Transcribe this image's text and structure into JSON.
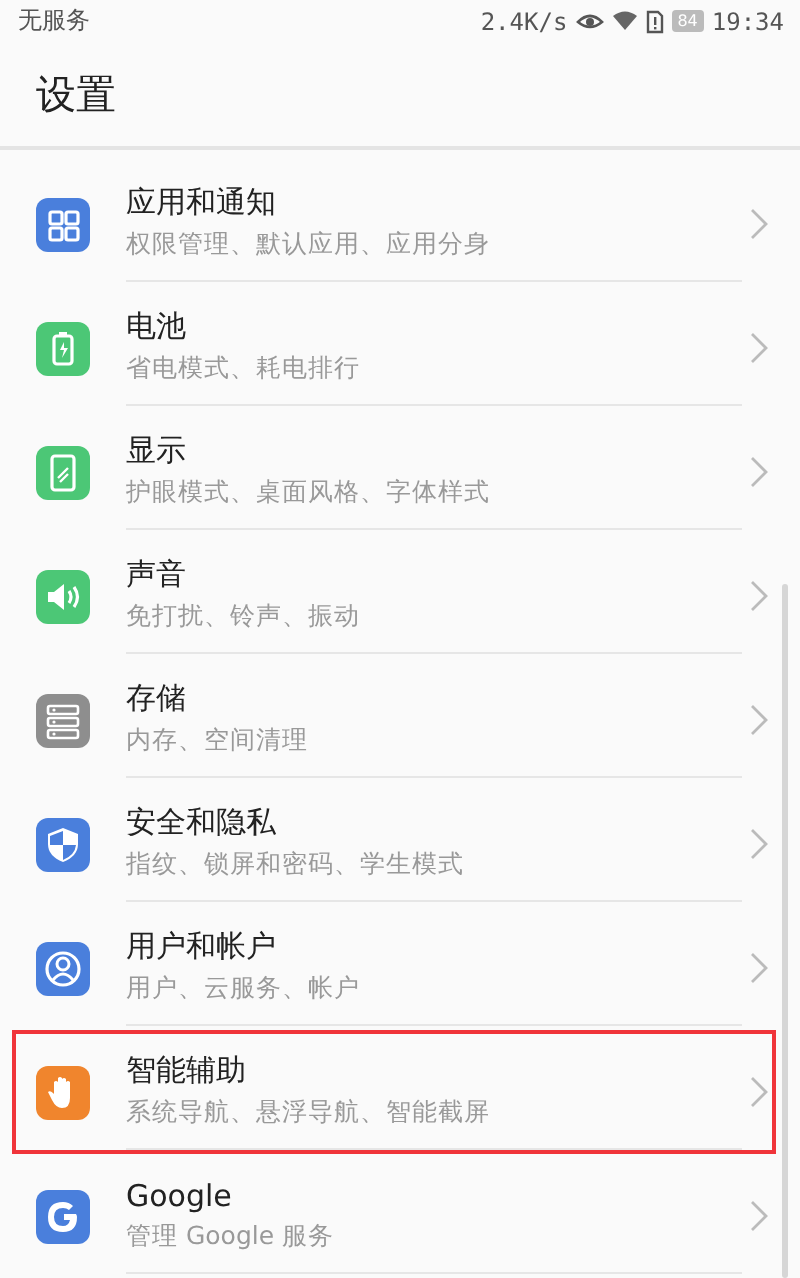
{
  "status_bar": {
    "carrier": "无服务",
    "speed": "2.4K/s",
    "battery": "84",
    "time": "19:34"
  },
  "title": "设置",
  "items": [
    {
      "kind": "apps",
      "color": "#4a7fdc",
      "title": "应用和通知",
      "subtitle": "权限管理、默认应用、应用分身",
      "highlighted": false
    },
    {
      "kind": "battery",
      "color": "#4cc776",
      "title": "电池",
      "subtitle": "省电模式、耗电排行",
      "highlighted": false
    },
    {
      "kind": "display",
      "color": "#4cc776",
      "title": "显示",
      "subtitle": "护眼模式、桌面风格、字体样式",
      "highlighted": false
    },
    {
      "kind": "sound",
      "color": "#4cc776",
      "title": "声音",
      "subtitle": "免打扰、铃声、振动",
      "highlighted": false
    },
    {
      "kind": "storage",
      "color": "#8e8e8e",
      "title": "存储",
      "subtitle": "内存、空间清理",
      "highlighted": false
    },
    {
      "kind": "shield",
      "color": "#4a7fdc",
      "title": "安全和隐私",
      "subtitle": "指纹、锁屏和密码、学生模式",
      "highlighted": false
    },
    {
      "kind": "user",
      "color": "#4a7fdc",
      "title": "用户和帐户",
      "subtitle": "用户、云服务、帐户",
      "highlighted": false
    },
    {
      "kind": "hand",
      "color": "#f0852d",
      "title": "智能辅助",
      "subtitle": "系统导航、悬浮导航、智能截屏",
      "highlighted": true
    },
    {
      "kind": "google",
      "color": "#4a7fdc",
      "title": "Google",
      "subtitle": "管理 Google 服务",
      "highlighted": false
    }
  ]
}
